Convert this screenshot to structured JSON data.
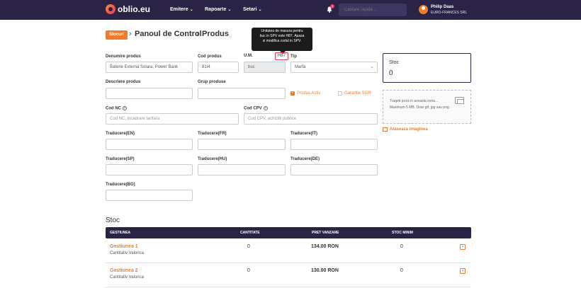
{
  "navbar": {
    "logo_text": "oblio.eu",
    "menu": [
      {
        "label": "Emitere"
      },
      {
        "label": "Rapoarte"
      },
      {
        "label": "Setari"
      }
    ],
    "notification_count": "3",
    "search_placeholder": "Cautare rapida ...",
    "user_name": "Philip Daas",
    "user_company": "EURO-FRANCES SRL"
  },
  "breadcrumb": {
    "badge": "Stocuri",
    "items": [
      "Panoul de Control",
      "Produs"
    ]
  },
  "tooltip": {
    "lines": [
      "Unitatea de masura pentru",
      "buc in SPV este H87. Apasa",
      "si modifica codul in SPV."
    ]
  },
  "form": {
    "name_label": "Denumire produs",
    "name_value": "Baterie Externa Solara, Power Bank",
    "code_label": "Cod produs",
    "code_value": "81I4",
    "um_label": "U.M.",
    "um_value": "buc",
    "um_spv_code": "H87",
    "type_label": "Tip",
    "type_value": "Marfa",
    "description_label": "Descriere produs",
    "group_label": "Grup produse",
    "active_label": "Produs Activ",
    "sgr_label": "Garantie SGR",
    "nc_label": "Cod NC",
    "nc_placeholder": "Cod NC, incadrare tarifara",
    "cpv_label": "Cod CPV",
    "cpv_placeholder": "Cod CPV, achizitii publice",
    "translations": [
      {
        "label": "Traducere(EN)"
      },
      {
        "label": "Traducere(FR)"
      },
      {
        "label": "Traducere(IT)"
      },
      {
        "label": "Traducere(SP)"
      },
      {
        "label": "Traducere(HU)"
      },
      {
        "label": "Traducere(DE)"
      },
      {
        "label": "Traducere(BG)"
      }
    ]
  },
  "stock_card": {
    "label": "Stoc",
    "value": "0"
  },
  "image": {
    "drop_line1": "Trageti poza in aceasta zona...",
    "drop_line2": "Maximum 5 MB. Doar gif, jpg sau png.",
    "attach_label": "Ataseaza imaginea"
  },
  "stock_section": {
    "title": "Stoc",
    "headers": [
      "GESTIUNEA",
      "CANTITATE",
      "PRET VANZARE",
      "STOC MINIM"
    ],
    "rows": [
      {
        "name": "Gestiunea 1",
        "method": "Cantitativ Valorica",
        "quantity": "0",
        "price": "134.00 RON",
        "min_stock": "0"
      },
      {
        "name": "Gestiunea 2",
        "method": "Cantitativ Valorica",
        "quantity": "0",
        "price": "130.00 RON",
        "min_stock": "0"
      }
    ]
  },
  "colors": {
    "navbar": "#2a2346",
    "accent": "#f07c2a",
    "alert": "#e53958"
  }
}
